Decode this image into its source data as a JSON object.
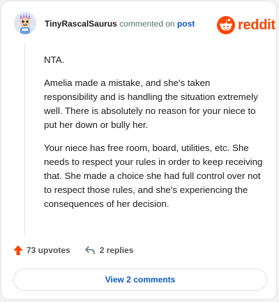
{
  "header": {
    "username": "TinyRascalSaurus",
    "action_text": "commented on",
    "post_link": "post"
  },
  "logo": {
    "text": "reddit",
    "icon": "reddit-alien-icon",
    "color": "#ff4500"
  },
  "comment": {
    "paragraphs": [
      "NTA.",
      "Amelia made a mistake, and she's taken responsibility and is handling the situation extremely well. There is absolutely no reason for your niece to put her down or bully her.",
      "Your niece has free room, board, utilities, etc. She needs to respect your rules in order to keep receiving that. She made a choice she had full control over not to respect those rules, and she's experiencing the consequences of her decision."
    ]
  },
  "actions": {
    "upvotes_label": "73 upvotes",
    "upvote_icon": "upvote-arrow-icon",
    "upvote_color": "#ff4500",
    "replies_label": "2 replies",
    "reply_icon": "reply-arrow-icon"
  },
  "footer": {
    "view_comments_label": "View 2 comments",
    "link_color": "#0a58ca"
  }
}
